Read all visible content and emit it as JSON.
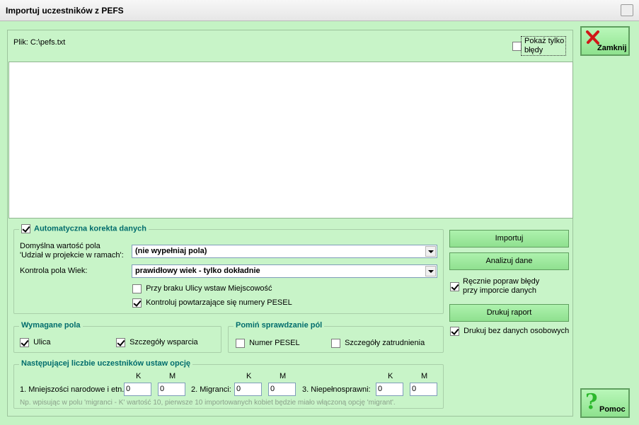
{
  "window": {
    "title": "Importuj uczestników z PEFS"
  },
  "file": {
    "label": "Plik: C:\\pefs.txt"
  },
  "show_errors": {
    "label_line1": "Pokaż tylko",
    "label_line2": "błędy",
    "checked": false
  },
  "auto_correct": {
    "legend": "Automatyczna korekta danych",
    "checked": true,
    "default_field_label_line1": "Domyślna wartość pola",
    "default_field_label_line2": "'Udział w projekcie w ramach':",
    "default_field_value": "(nie wypełniaj pola)",
    "age_label": "Kontrola pola Wiek:",
    "age_value": "prawidłowy wiek - tylko dokładnie",
    "street_option": "Przy braku Ulicy wstaw Miejscowość",
    "street_checked": false,
    "pesel_option": "Kontroluj powtarzające się numery PESEL",
    "pesel_checked": true
  },
  "buttons": {
    "import": "Importuj",
    "analyze": "Analizuj dane",
    "print_report": "Drukuj raport",
    "close": "Zamknij",
    "help": "Pomoc"
  },
  "side_options": {
    "manual_fix_line1": "Ręcznie popraw błędy",
    "manual_fix_line2": "przy imporcie danych",
    "manual_fix_checked": true,
    "print_no_personal": "Drukuj bez danych osobowych",
    "print_no_personal_checked": true
  },
  "required_fields": {
    "legend": "Wymagane pola",
    "street": "Ulica",
    "street_checked": true,
    "support_details": "Szczegóły wsparcia",
    "support_checked": true
  },
  "skip_checks": {
    "legend": "Pomiń sprawdzanie pól",
    "pesel": "Numer PESEL",
    "pesel_checked": false,
    "employment": "Szczegóły zatrudnienia",
    "employment_checked": false
  },
  "participants": {
    "legend": "Następującej liczbie uczestników ustaw opcję",
    "k": "K",
    "m": "M",
    "minorities_label": "1. Mniejszości narodowe i etn.:",
    "minorities_k": "0",
    "minorities_m": "0",
    "migrants_label": "2. Migranci:",
    "migrants_k": "0",
    "migrants_m": "0",
    "disabled_label": "3. Niepełnosprawni:",
    "disabled_k": "0",
    "disabled_m": "0",
    "hint": "Np. wpisując w polu 'migranci - K' wartość 10, pierwsze 10 importowanych kobiet będzie miało włączoną opcję 'migrant'."
  },
  "colors": {
    "background": "#c4f3c4",
    "legend_text": "#006c6c",
    "button": "#8fe08f"
  }
}
